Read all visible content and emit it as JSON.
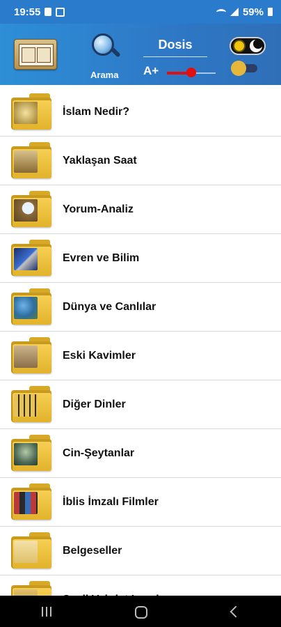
{
  "status": {
    "time": "19:55",
    "battery": "59%"
  },
  "header": {
    "search_label": "Arama",
    "font_name": "Dosis",
    "font_size_label": "A+",
    "font_size_level": 0.5
  },
  "categories": [
    {
      "label": "İslam Nedir?",
      "image": "quran-calligraphy-image"
    },
    {
      "label": "Yaklaşan Saat",
      "image": "open-book-image"
    },
    {
      "label": "Yorum-Analiz",
      "image": "magnifier-image"
    },
    {
      "label": "Evren ve Bilim",
      "image": "satellite-image"
    },
    {
      "label": "Dünya ve Canlılar",
      "image": "earth-image"
    },
    {
      "label": "Eski Kavimler",
      "image": "ruins-image"
    },
    {
      "label": "Diğer Dinler",
      "image": "religious-symbols-image"
    },
    {
      "label": "Cin-Şeytanlar",
      "image": "alien-image"
    },
    {
      "label": "İblis İmzalı Filmler",
      "image": "film-posters-image"
    },
    {
      "label": "Belgeseller",
      "image": "documentary-list-image"
    },
    {
      "label": "Sesli Vahdet Imzalar",
      "image": "audio-image"
    }
  ],
  "colors": {
    "statusbar": "#2a7bcc",
    "header": "#2e78c6",
    "folder": "#e2b32b",
    "slider": "#e01010"
  }
}
